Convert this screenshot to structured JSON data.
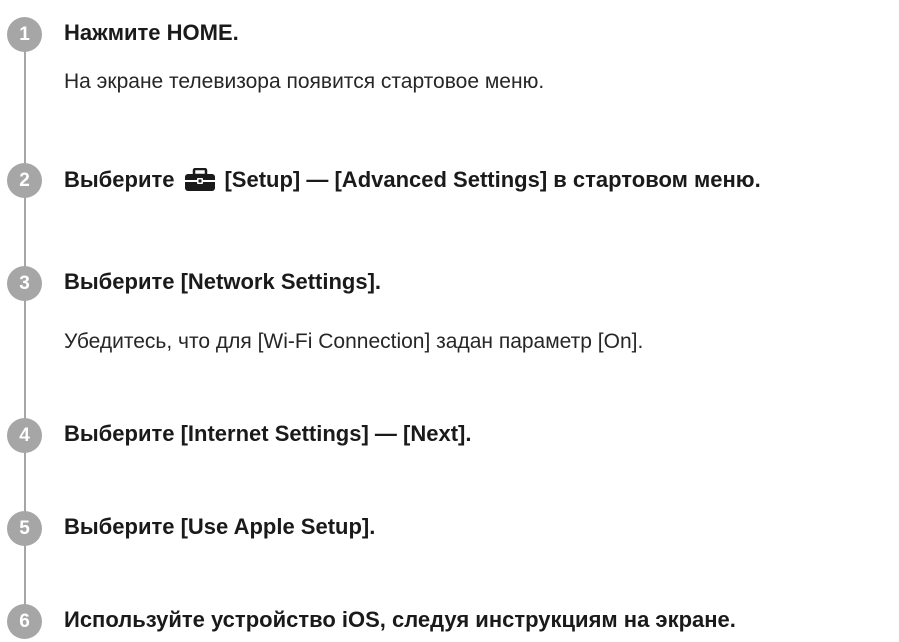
{
  "steps": [
    {
      "number": "1",
      "title": "Нажмите HOME.",
      "description": "На экране телевизора появится стартовое меню."
    },
    {
      "number": "2",
      "title_prefix": "Выберите",
      "icon": "toolbox-icon",
      "title_suffix": "[Setup] — [Advanced Settings] в стартовом меню."
    },
    {
      "number": "3",
      "title": "Выберите [Network Settings].",
      "description": "Убедитесь, что для [Wi-Fi Connection] задан параметр [On]."
    },
    {
      "number": "4",
      "title": "Выберите [Internet Settings] — [Next]."
    },
    {
      "number": "5",
      "title": "Выберите [Use Apple Setup]."
    },
    {
      "number": "6",
      "title": "Используйте устройство iOS, следуя инструкциям на экране."
    }
  ],
  "colors": {
    "badge": "#a6a6a6",
    "text": "#1a1a1a"
  }
}
